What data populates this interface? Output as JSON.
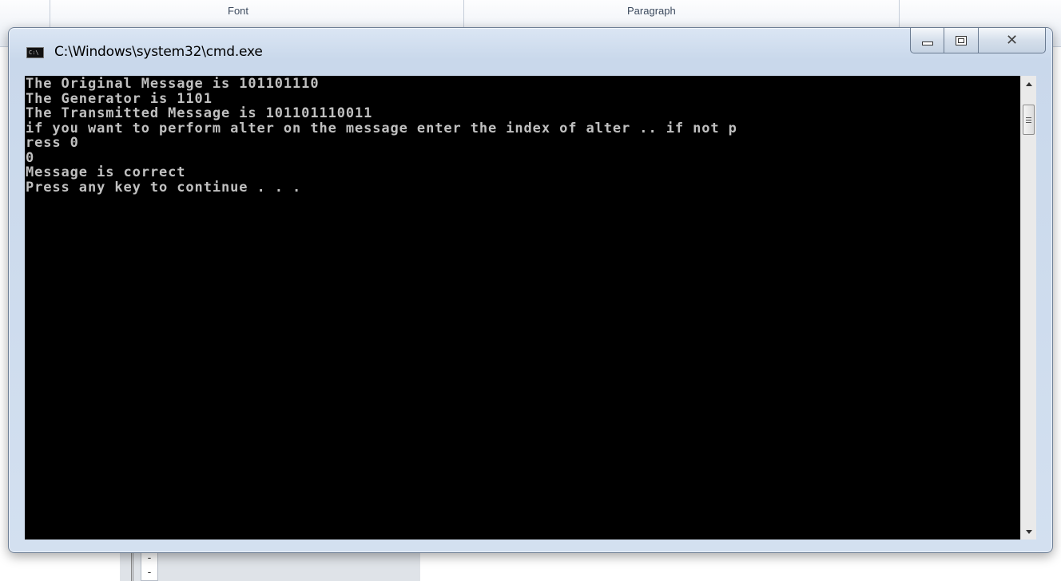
{
  "background": {
    "group_labels": [
      "Font",
      "Paragraph"
    ]
  },
  "window": {
    "title": "C:\\Windows\\system32\\cmd.exe",
    "icon_label": "C:\\",
    "minimize_icon": "minimize-icon",
    "maximize_icon": "maximize-icon",
    "close_icon": "close-icon",
    "close_glyph": "✕"
  },
  "console": {
    "lines": [
      "The Original Message is 101101110",
      "The Generator is 1101",
      "The Transmitted Message is 101101110011",
      "if you want to perform alter on the message enter the index of alter .. if not p",
      "ress 0",
      "0",
      "Message is correct",
      "Press any key to continue . . ."
    ]
  },
  "colors": {
    "console_bg": "#000000",
    "console_text": "#c0c0c0",
    "window_frame": "#c9d8eb"
  }
}
